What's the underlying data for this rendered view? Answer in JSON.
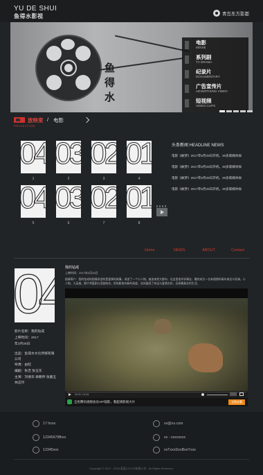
{
  "header": {
    "logo_en": "YU DE SHUI",
    "logo_cn": "鱼得水影视",
    "location": "青岛东方影都"
  },
  "banner": {
    "brand_vertical": "鱼\n得\n水",
    "menu": [
      {
        "title": "电影",
        "sub": "MOVIE"
      },
      {
        "title": "系列剧",
        "sub": "TV DRAMA"
      },
      {
        "title": "纪录片",
        "sub": "DOCUMENTARY"
      },
      {
        "title": "广告宣传片",
        "sub": "ADVERTISING VIDEO"
      },
      {
        "title": "短视频",
        "sub": "VIDEO CLIPS"
      }
    ],
    "slide_count": 5
  },
  "breadcrumb": {
    "section": "放映室",
    "section_sub": "PROJECTION",
    "separator": "/",
    "current": "电影"
  },
  "thumbnails": [
    {
      "num": "04",
      "caption": "1"
    },
    {
      "num": "03",
      "caption": "2"
    },
    {
      "num": "02",
      "caption": "3"
    },
    {
      "num": "01",
      "caption": "4"
    },
    {
      "num": "04",
      "caption": "5"
    },
    {
      "num": "03",
      "caption": "6"
    },
    {
      "num": "02",
      "caption": "7"
    },
    {
      "num": "01",
      "caption": "8"
    }
  ],
  "news": {
    "title": "头条新闻  HEADLINE NEWS",
    "items": [
      "电影《故梦》2017年5月28日开机，30多家媒体採",
      "电影《故梦》2017年5月28日开机，30多家媒体採",
      "电影《故梦》2017年5月28日开机，30多家媒体採",
      "电影《故梦》2017年5月28日开机，30多家媒体採"
    ]
  },
  "nav": {
    "home": "Home",
    "news": "NEWS",
    "about": "ABOUT",
    "contact": "Contact"
  },
  "detail": {
    "big_num": "04",
    "name": "影片名称：我的钻戒",
    "time1": "上映时间：2017",
    "time2": "年3月25日",
    "producer1": "出品：鱼得水文化传媒有限",
    "producer2": "公司",
    "director": "导演：由旺",
    "writer": "编剧：张吉 张玉东",
    "actors1": "主演：刘德华 梁朝伟 张曼玉",
    "actors2": "林志玲",
    "video_title": "我的钻戒",
    "video_date": "上映时间：2017年3月25日",
    "video_desc": "剧情简介：我的钻戒的剧情讲述的是爱情的故事，讲述了一个小人物，被迫来到大都市，在这里他寻求事业，最终成为一名有理想的青年演员与导演，小人物，大英雄，影片将喜剧与悲剧结合，把电影推向新的高度，深刻展现了命运与爱情交织，还原最真实的生活。"
  },
  "player": {
    "time": "00:00 / 01:54",
    "ad_text": "全民腾讯视频会员VIP观影，看超清影视大片",
    "ad_button": "立即去看"
  },
  "footer": {
    "phone": "17 hxxx",
    "email": "xx@xx.com",
    "fax": "12345678fhxx",
    "tel2": "xx - xxxxxxxx",
    "qq": "12345xxx",
    "address": "xxTxxxDxxBxxYxxx"
  },
  "copyright": "Copyright © 2017 - 2018 某某XXXXX有限公司 . All Rights Reserved.",
  "colors": {
    "accent": "#d33b2c",
    "background": "#202427",
    "footer": "#1a1d20"
  }
}
